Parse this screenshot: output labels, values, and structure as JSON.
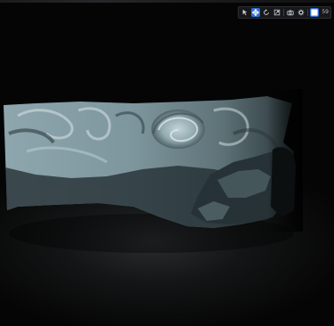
{
  "toolbar": {
    "tools": [
      {
        "name": "select-tool",
        "icon": "cursor-icon",
        "active": false
      },
      {
        "name": "move-tool",
        "icon": "move-arrows-icon",
        "active": true
      },
      {
        "name": "rotate-tool",
        "icon": "rotate-icon",
        "active": false
      },
      {
        "name": "scale-tool",
        "icon": "scale-icon",
        "active": false
      },
      {
        "name": "camera-tool",
        "icon": "camera-icon",
        "active": false
      },
      {
        "name": "settings-tool",
        "icon": "gear-icon",
        "active": false
      },
      {
        "name": "grid-tool",
        "icon": "grid-icon",
        "active": true
      }
    ],
    "fps_label": "59"
  },
  "colors": {
    "accent": "#2f6fd8",
    "relief_light": "#9fb6bd",
    "relief_shadow": "#1e2a2e",
    "background": "#000000"
  }
}
